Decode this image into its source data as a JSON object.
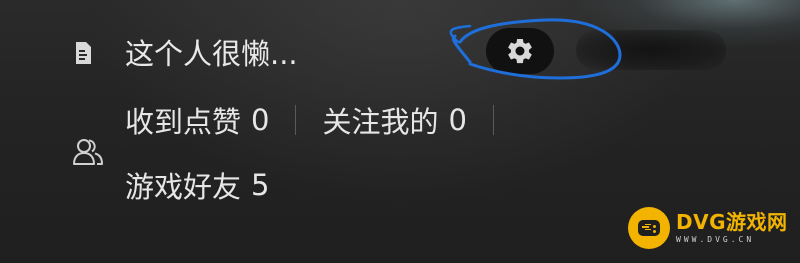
{
  "profile": {
    "bio": "这个人很懒...",
    "stats": [
      {
        "label": "收到点赞",
        "value": "0"
      },
      {
        "label": "关注我的",
        "value": "0"
      }
    ],
    "friends": {
      "label": "游戏好友",
      "value": "5"
    }
  },
  "watermark": {
    "title": "DVG游戏网",
    "url": "WWW.DVG.CN"
  },
  "icons": {
    "bio": "document-icon",
    "friends": "people-icon",
    "settings": "gear-icon"
  },
  "colors": {
    "background": "#1f1f1f",
    "text": "#e6e6e6",
    "annotation": "#1e6fd9",
    "watermark_accent": "#f2b400"
  }
}
